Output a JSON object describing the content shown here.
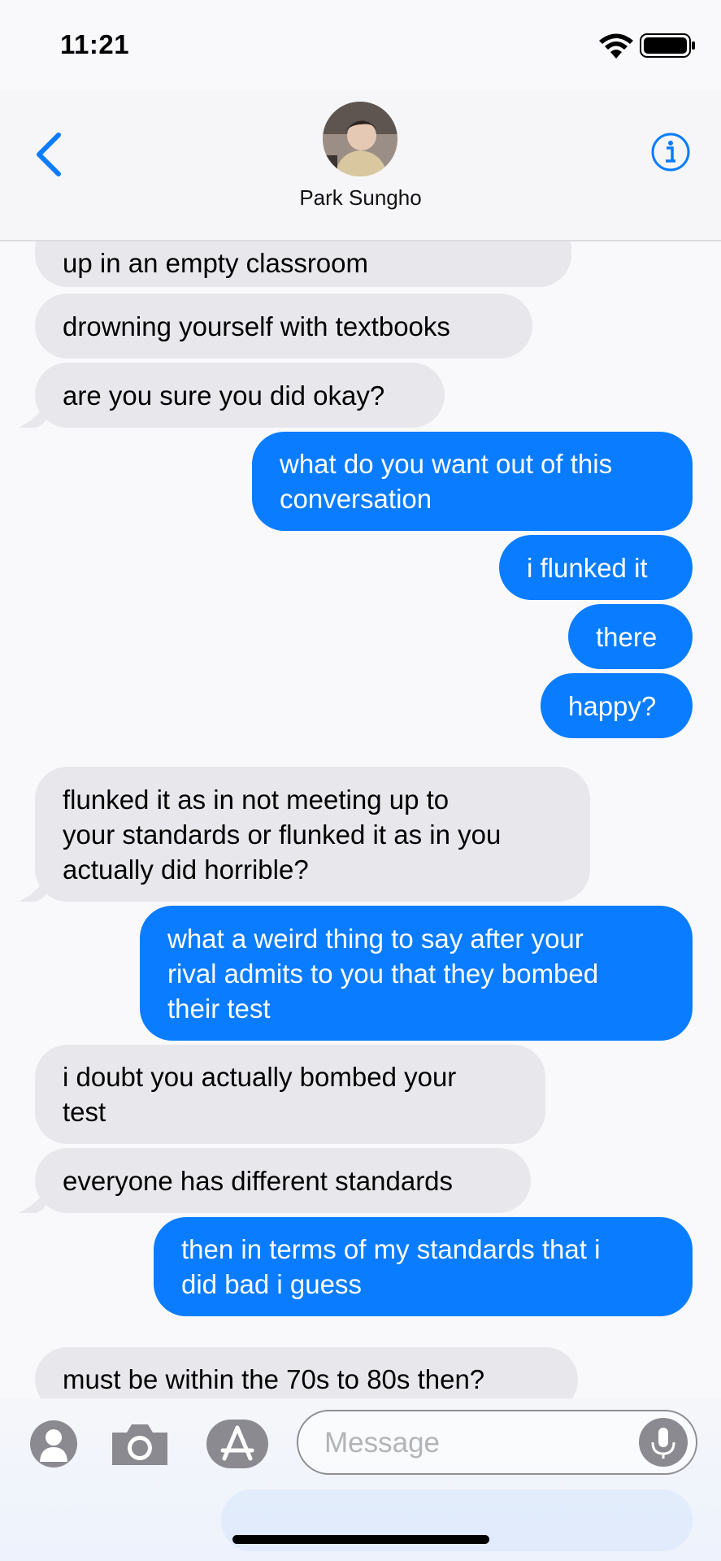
{
  "status": {
    "time": "11:21"
  },
  "header": {
    "contact_name": "Park Sungho"
  },
  "messages": [
    {
      "from": "them",
      "text": "up in an empty classroom"
    },
    {
      "from": "them",
      "text": "drowning yourself with textbooks"
    },
    {
      "from": "them",
      "text": "are you sure you did okay?"
    },
    {
      "from": "me",
      "text": "what do you want out of this\nconversation"
    },
    {
      "from": "me",
      "text": "i flunked it"
    },
    {
      "from": "me",
      "text": "there"
    },
    {
      "from": "me",
      "text": "happy?"
    },
    {
      "from": "them",
      "text": "flunked it as in not meeting up to\nyour standards or flunked it as in you\nactually did horrible?"
    },
    {
      "from": "me",
      "text": "what a weird thing to say after your\nrival admits to you that they bombed\ntheir test"
    },
    {
      "from": "them",
      "text": "i doubt you actually bombed your\ntest"
    },
    {
      "from": "them",
      "text": "everyone has different standards"
    },
    {
      "from": "me",
      "text": "then in terms of my standards that i\ndid bad i guess"
    },
    {
      "from": "them",
      "text": "must be within the 70s to 80s then?"
    }
  ],
  "input": {
    "placeholder": "Message"
  },
  "colors": {
    "outgoing": "#0a7cff",
    "incoming": "#e8e7ec",
    "accent": "#0a7cff"
  },
  "icons": [
    "wifi-icon",
    "battery-icon",
    "chevron-left-icon",
    "info-icon",
    "contacts-icon",
    "camera-icon",
    "app-store-icon",
    "microphone-icon"
  ]
}
